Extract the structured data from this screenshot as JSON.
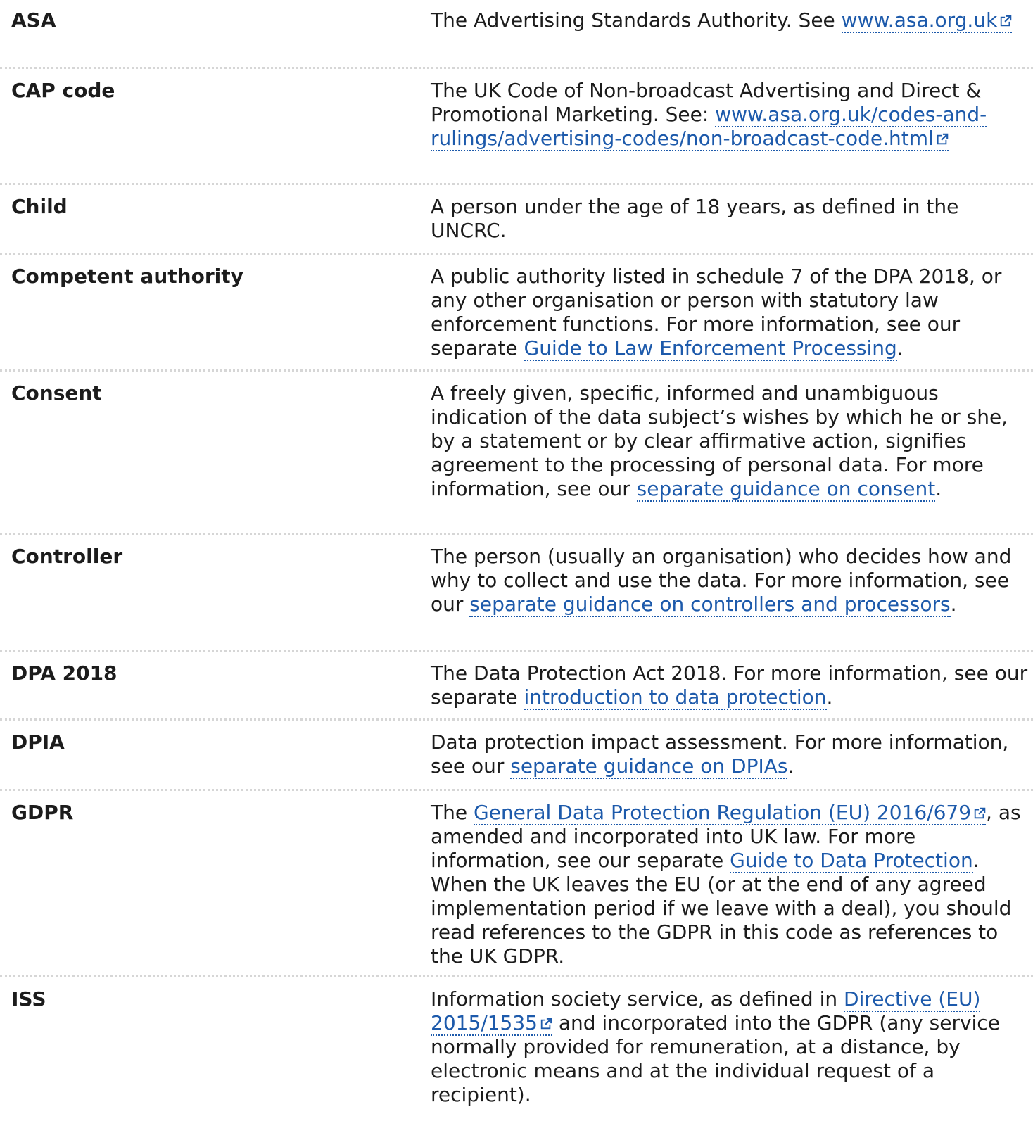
{
  "entries": [
    {
      "term": "ASA",
      "def": [
        {
          "t": "text",
          "v": "The Advertising Standards Authority. See "
        },
        {
          "t": "link",
          "v": "www.asa.org.uk",
          "ext": true
        }
      ]
    },
    {
      "term": "CAP code",
      "def": [
        {
          "t": "text",
          "v": "The UK Code of Non-broadcast Advertising and Direct & Promotional Marketing. See: "
        },
        {
          "t": "link",
          "v": "www.asa.org.uk/codes-and-rulings/advertising-codes/non-broadcast-code.html",
          "ext": true
        }
      ]
    },
    {
      "term": "Child",
      "def": [
        {
          "t": "text",
          "v": "A person under the age of 18 years, as defined in the UNCRC."
        }
      ]
    },
    {
      "term": "Competent authority",
      "def": [
        {
          "t": "text",
          "v": "A public authority listed in schedule 7 of the DPA 2018, or any other organisation or person with statutory law enforcement functions. For more information, see our separate "
        },
        {
          "t": "link",
          "v": "Guide to Law Enforcement Processing",
          "ext": false
        },
        {
          "t": "text",
          "v": "."
        }
      ]
    },
    {
      "term": "Consent",
      "def": [
        {
          "t": "text",
          "v": "A freely given, specific, informed and unambiguous indication of the data subject’s wishes by which he or she, by a statement or by clear affirmative action, signifies agreement to the processing of personal data. For more information, see our "
        },
        {
          "t": "link",
          "v": "separate guidance on consent",
          "ext": false
        },
        {
          "t": "text",
          "v": "."
        }
      ]
    },
    {
      "term": "Controller",
      "def": [
        {
          "t": "text",
          "v": "The person (usually an organisation) who decides how and why to collect and use the data. For more information, see our "
        },
        {
          "t": "link",
          "v": "separate guidance on controllers and processors",
          "ext": false
        },
        {
          "t": "text",
          "v": "."
        }
      ]
    },
    {
      "term": "DPA 2018",
      "def": [
        {
          "t": "text",
          "v": "The Data Protection Act 2018. For more information, see our separate "
        },
        {
          "t": "link",
          "v": "introduction to data protection",
          "ext": false
        },
        {
          "t": "text",
          "v": "."
        }
      ]
    },
    {
      "term": "DPIA",
      "def": [
        {
          "t": "text",
          "v": "Data protection impact assessment. For more information, see our "
        },
        {
          "t": "link",
          "v": "separate guidance on DPIAs",
          "ext": false
        },
        {
          "t": "text",
          "v": "."
        }
      ]
    },
    {
      "term": "GDPR",
      "def": [
        {
          "t": "text",
          "v": "The "
        },
        {
          "t": "link",
          "v": "General Data Protection Regulation (EU) 2016/679",
          "ext": true
        },
        {
          "t": "text",
          "v": ", as amended and incorporated into UK law. For more information, see our separate "
        },
        {
          "t": "link",
          "v": "Guide to Data Protection",
          "ext": false
        },
        {
          "t": "text",
          "v": ". When the UK leaves the EU (or at the end of any agreed implementation period if we leave with a deal), you should read references to the GDPR in this code as references to the UK GDPR."
        }
      ]
    },
    {
      "term": "ISS",
      "def": [
        {
          "t": "text",
          "v": "Information society service, as defined in "
        },
        {
          "t": "link",
          "v": "Directive (EU) 2015/1535",
          "ext": true
        },
        {
          "t": "text",
          "v": " and incorporated into the GDPR (any service normally provided for remuneration, at a distance, by electronic means and at the individual request of a recipient)."
        }
      ]
    }
  ],
  "colors": {
    "link": "#1d5aab",
    "text": "#1c1c1c",
    "divider": "#d6d6d6"
  },
  "icons": {
    "external": "external-link-icon"
  }
}
